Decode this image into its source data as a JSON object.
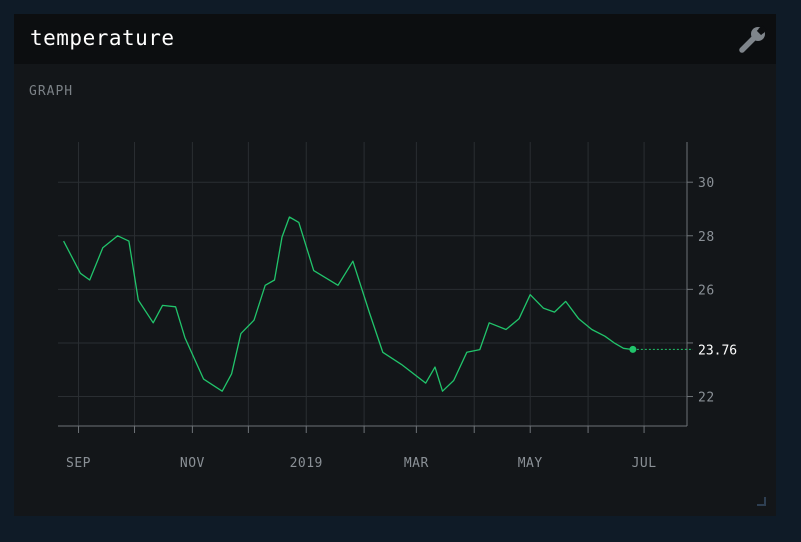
{
  "panel": {
    "title": "temperature",
    "section_label": "GRAPH",
    "settings_icon": "wrench-icon"
  },
  "colors": {
    "line": "#21c46b",
    "grid": "#2a2e32",
    "axis": "#6e7378",
    "tick_text": "#8a9096",
    "last_value_text": "#ffffff",
    "panel_bg": "#131619",
    "header_bg": "#0c0e10",
    "page_bg": "#0f1b27"
  },
  "chart_data": {
    "type": "line",
    "title": "",
    "xlabel": "",
    "ylabel": "",
    "x_ticks": [
      {
        "date": "2018-09-01",
        "label": "SEP"
      },
      {
        "date": "2018-11-01",
        "label": "NOV"
      },
      {
        "date": "2019-01-01",
        "label": "2019"
      },
      {
        "date": "2019-03-01",
        "label": "MAR"
      },
      {
        "date": "2019-05-01",
        "label": "MAY"
      },
      {
        "date": "2019-07-01",
        "label": "JUL"
      }
    ],
    "x_minor_ticks": [
      "2018-10-01",
      "2018-12-01",
      "2019-02-01",
      "2019-04-01",
      "2019-06-01"
    ],
    "y_ticks": [
      22,
      24,
      26,
      28,
      30
    ],
    "y_tick_labels": [
      {
        "value": 22,
        "label": "22"
      },
      {
        "value": 26,
        "label": "26"
      },
      {
        "value": 28,
        "label": "28"
      },
      {
        "value": 30,
        "label": "30"
      }
    ],
    "ylim": [
      20.9,
      31.5
    ],
    "xlim": [
      "2018-08-21",
      "2019-07-24"
    ],
    "y_axis_position": "right",
    "grid": true,
    "last_value": {
      "date": "2019-06-25",
      "value": 23.76,
      "label": "23.76"
    },
    "series": [
      {
        "x": [
          "2018-08-24",
          "2018-09-02",
          "2018-09-07",
          "2018-09-14",
          "2018-09-22",
          "2018-09-28",
          "2018-10-03",
          "2018-10-11",
          "2018-10-16",
          "2018-10-23",
          "2018-10-28",
          "2018-11-07",
          "2018-11-17",
          "2018-11-22",
          "2018-11-27",
          "2018-12-04",
          "2018-12-10",
          "2018-12-15",
          "2018-12-19",
          "2018-12-23",
          "2018-12-28",
          "2019-01-05",
          "2019-01-18",
          "2019-01-26",
          "2019-02-04",
          "2019-02-11",
          "2019-02-21",
          "2019-03-06",
          "2019-03-11",
          "2019-03-15",
          "2019-03-21",
          "2019-03-28",
          "2019-04-04",
          "2019-04-09",
          "2019-04-18",
          "2019-04-25",
          "2019-05-01",
          "2019-05-08",
          "2019-05-14",
          "2019-05-20",
          "2019-05-27",
          "2019-06-03",
          "2019-06-10",
          "2019-06-15",
          "2019-06-20",
          "2019-06-24",
          "2019-06-25"
        ],
        "values": [
          27.8,
          26.6,
          26.35,
          27.55,
          28.0,
          27.8,
          25.6,
          24.75,
          25.4,
          25.35,
          24.2,
          22.65,
          22.2,
          22.85,
          24.35,
          24.85,
          26.15,
          26.35,
          27.95,
          28.7,
          28.5,
          26.7,
          26.15,
          27.05,
          25.1,
          23.65,
          23.2,
          22.5,
          23.1,
          22.2,
          22.6,
          23.65,
          23.75,
          24.75,
          24.5,
          24.9,
          25.8,
          25.3,
          25.15,
          25.55,
          24.9,
          24.5,
          24.25,
          24.0,
          23.8,
          23.76,
          23.76
        ]
      }
    ]
  }
}
